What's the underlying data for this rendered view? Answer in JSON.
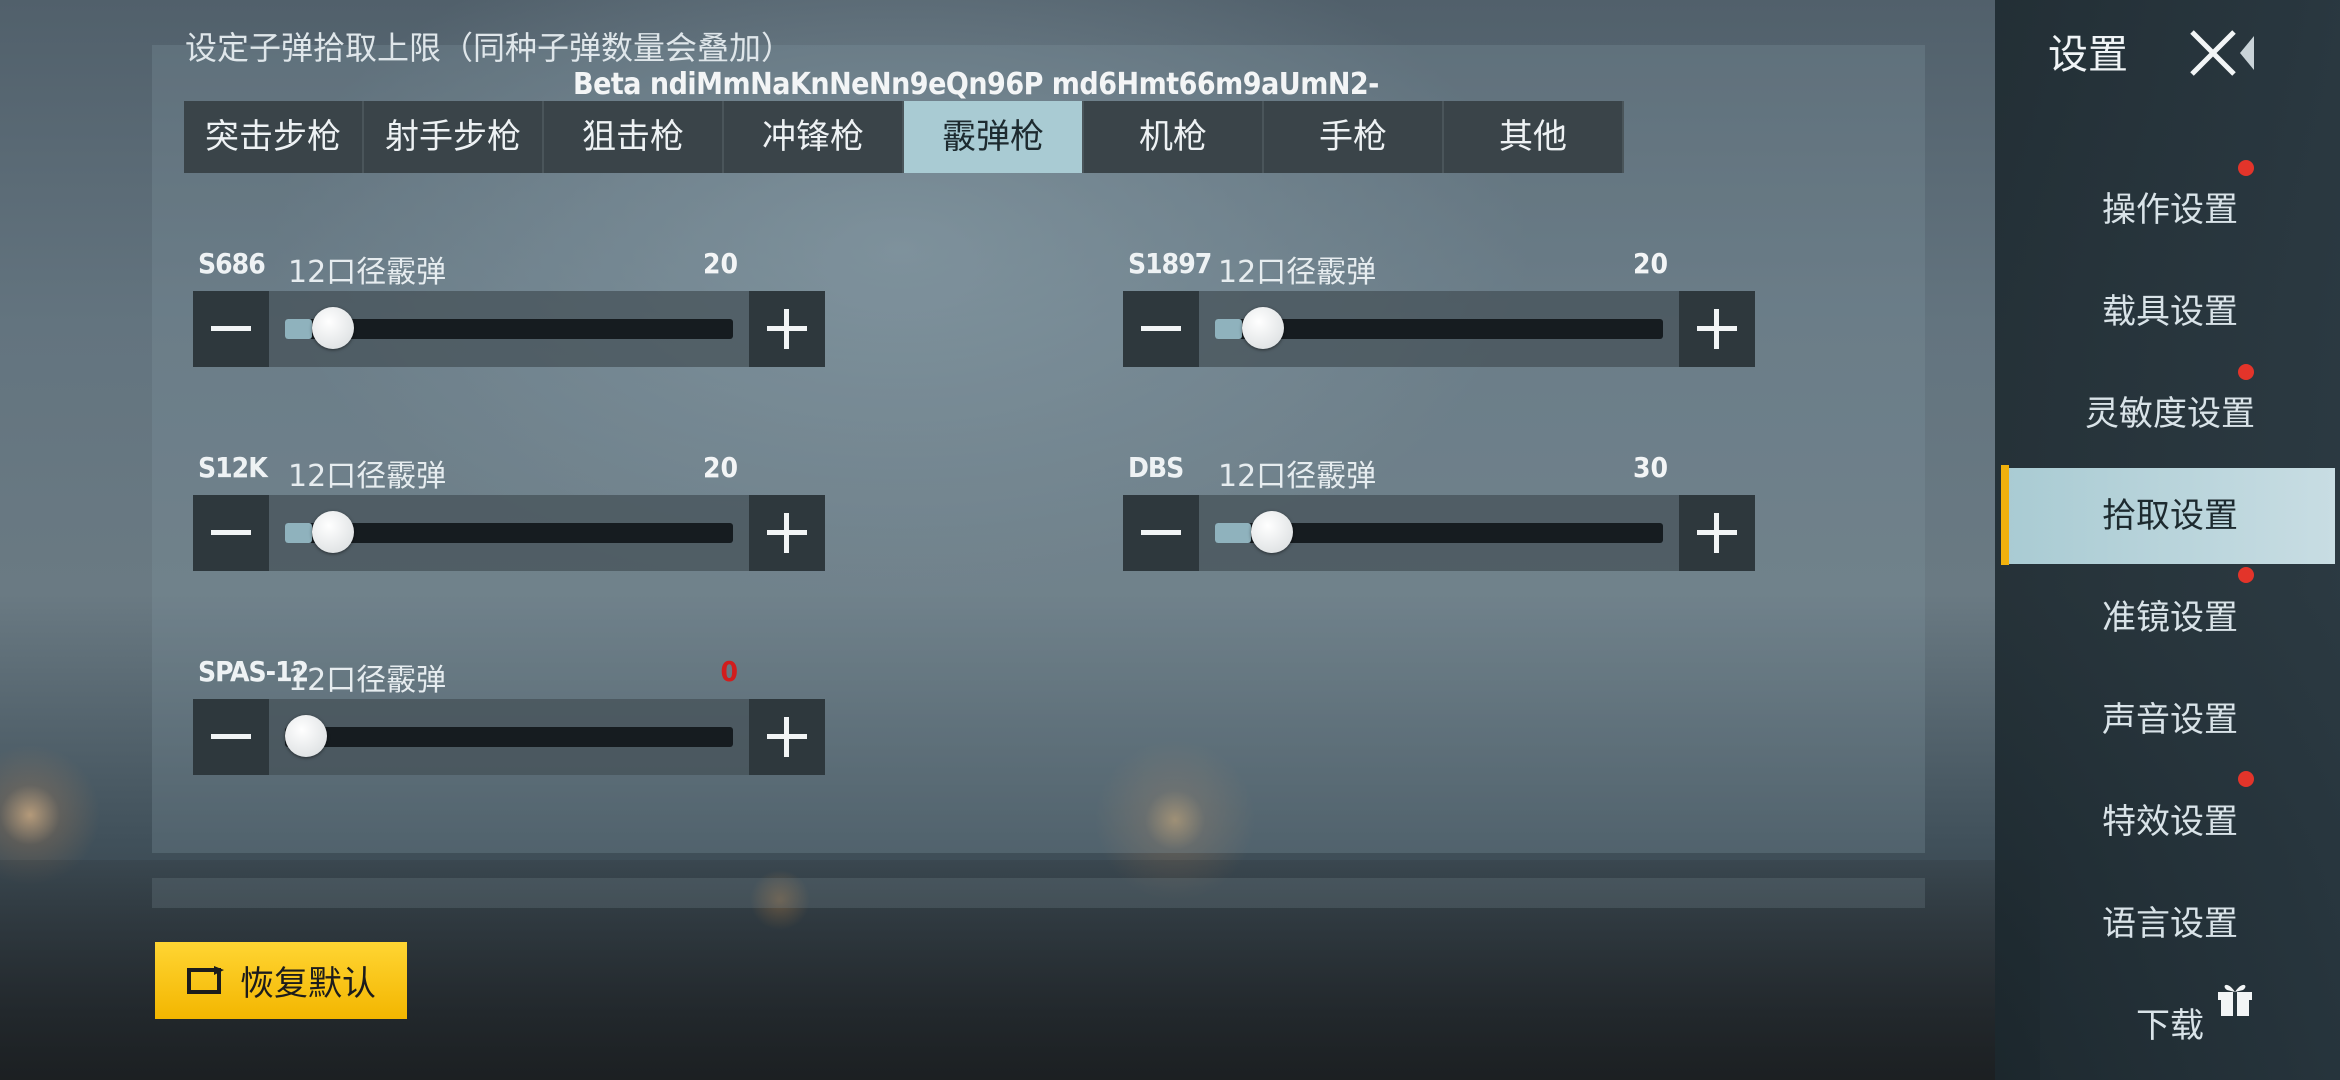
{
  "header": {
    "partial_text": "设定子弹拾取上限（同种子弹数量会叠加）",
    "beta_text": "Beta ndiMmNaKnNeNn9eQn96P md6Hmt66m9aUmN2-"
  },
  "tabs": [
    {
      "label": "突击步枪",
      "active": false
    },
    {
      "label": "射手步枪",
      "active": false
    },
    {
      "label": "狙击枪",
      "active": false
    },
    {
      "label": "冲锋枪",
      "active": false
    },
    {
      "label": "霰弹枪",
      "active": true
    },
    {
      "label": "机枪",
      "active": false
    },
    {
      "label": "手枪",
      "active": false
    },
    {
      "label": "其他",
      "active": false
    }
  ],
  "items": [
    {
      "name": "S686",
      "ammo": "12口径霰弹",
      "count": "20",
      "level": 0.06
    },
    {
      "name": "S1897",
      "ammo": "12口径霰弹",
      "count": "20",
      "level": 0.06
    },
    {
      "name": "S12K",
      "ammo": "12口径霰弹",
      "count": "20",
      "level": 0.06
    },
    {
      "name": "DBS",
      "ammo": "12口径霰弹",
      "count": "30",
      "level": 0.08
    },
    {
      "name": "SPAS-12",
      "ammo": "12口径霰弹",
      "count": "0",
      "level": 0.0
    }
  ],
  "restore_button": {
    "label": "恢复默认"
  },
  "sidebar": {
    "title": "设置",
    "items": [
      {
        "label": "操作设置",
        "active": false
      },
      {
        "label": "载具设置",
        "active": false
      },
      {
        "label": "灵敏度设置",
        "active": false
      },
      {
        "label": "拾取设置",
        "active": true
      },
      {
        "label": "准镜设置",
        "active": false
      },
      {
        "label": "声音设置",
        "active": false
      },
      {
        "label": "特效设置",
        "active": false
      },
      {
        "label": "语言设置",
        "active": false
      },
      {
        "label": "下载",
        "active": false
      }
    ]
  },
  "icons": {
    "close": "close-icon",
    "gift": "gift-icon",
    "restore": "restore-icon",
    "minus": "minus-icon",
    "plus": "plus-icon"
  },
  "colors": {
    "accent": "#a9cbd3",
    "restore_bg": "#ffcc1a",
    "notice_dot": "#e3342a",
    "zero_count": "#d11d1d",
    "active_bar": "#f1b10c"
  }
}
